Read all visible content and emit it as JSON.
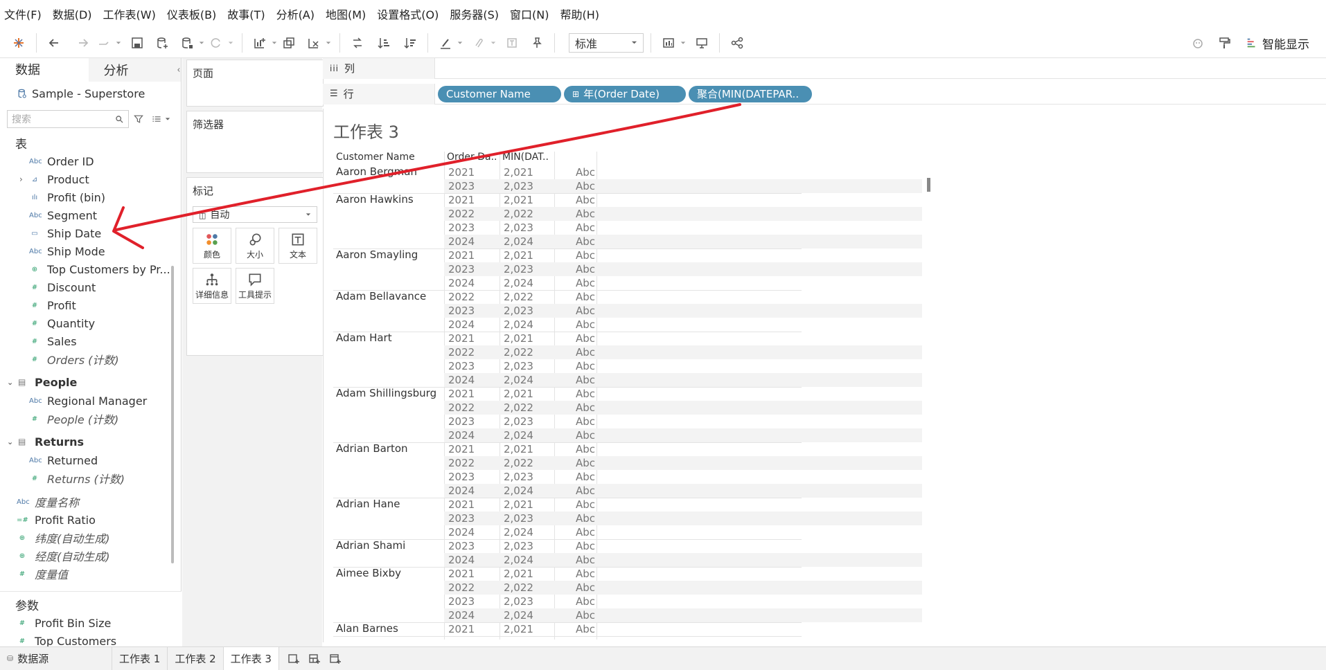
{
  "menu": [
    "文件(F)",
    "数据(D)",
    "工作表(W)",
    "仪表板(B)",
    "故事(T)",
    "分析(A)",
    "地图(M)",
    "设置格式(O)",
    "服务器(S)",
    "窗口(N)",
    "帮助(H)"
  ],
  "toolbar": {
    "fit_value": "标准",
    "show_me_label": "智能显示"
  },
  "data_pane": {
    "tab_data": "数据",
    "tab_analysis": "分析",
    "datasource": "Sample - Superstore",
    "search_placeholder": "搜索",
    "section_tables": "表",
    "fields": [
      {
        "icon": "Abc",
        "name": "Order ID"
      },
      {
        "icon": "⊿",
        "name": "Product"
      },
      {
        "icon": "ılı",
        "name": "Profit (bin)"
      },
      {
        "icon": "Abc",
        "name": "Segment"
      },
      {
        "icon": "▭",
        "name": "Ship Date"
      },
      {
        "icon": "Abc",
        "name": "Ship Mode"
      },
      {
        "icon": "⊕",
        "name": "Top Customers by Pr..."
      },
      {
        "icon": "#",
        "name": "Discount"
      },
      {
        "icon": "#",
        "name": "Profit"
      },
      {
        "icon": "#",
        "name": "Quantity"
      },
      {
        "icon": "#",
        "name": "Sales"
      },
      {
        "icon": "#",
        "name": "Orders (计数)"
      }
    ],
    "people_table": "People",
    "people_fields": [
      {
        "icon": "Abc",
        "name": "Regional Manager"
      },
      {
        "icon": "#",
        "name": "People (计数)"
      }
    ],
    "returns_table": "Returns",
    "returns_fields": [
      {
        "icon": "Abc",
        "name": "Returned"
      },
      {
        "icon": "#",
        "name": "Returns (计数)"
      }
    ],
    "extra_fields": [
      {
        "icon": "Abc",
        "name": "度量名称"
      },
      {
        "icon": "=#",
        "name": "Profit Ratio"
      },
      {
        "icon": "⊕",
        "name": "纬度(自动生成)"
      },
      {
        "icon": "⊕",
        "name": "经度(自动生成)"
      },
      {
        "icon": "#",
        "name": "度量值"
      }
    ],
    "section_params": "参数",
    "params": [
      {
        "icon": "#",
        "name": "Profit Bin Size"
      },
      {
        "icon": "#",
        "name": "Top Customers"
      }
    ]
  },
  "cards": {
    "pages": "页面",
    "filters": "筛选器",
    "marks": "标记",
    "marks_type": "自动",
    "mark_buttons": [
      "颜色",
      "大小",
      "文本",
      "详细信息",
      "工具提示"
    ]
  },
  "shelves": {
    "columns_label": "列",
    "rows_label": "行",
    "row_pills": [
      "Customer Name",
      "年(Order Date)",
      "聚合(MIN(DATEPAR.."
    ]
  },
  "sheet": {
    "title": "工作表 3",
    "headers": [
      "Customer Name",
      "Order Da..",
      "MIN(DAT.."
    ],
    "groups": [
      {
        "name": "Aaron Bergman",
        "rows": [
          [
            "2021",
            "2,021",
            "Abc"
          ],
          [
            "2023",
            "2,023",
            "Abc"
          ]
        ]
      },
      {
        "name": "Aaron Hawkins",
        "rows": [
          [
            "2021",
            "2,021",
            "Abc"
          ],
          [
            "2022",
            "2,022",
            "Abc"
          ],
          [
            "2023",
            "2,023",
            "Abc"
          ],
          [
            "2024",
            "2,024",
            "Abc"
          ]
        ]
      },
      {
        "name": "Aaron Smayling",
        "rows": [
          [
            "2021",
            "2,021",
            "Abc"
          ],
          [
            "2023",
            "2,023",
            "Abc"
          ],
          [
            "2024",
            "2,024",
            "Abc"
          ]
        ]
      },
      {
        "name": "Adam Bellavance",
        "rows": [
          [
            "2022",
            "2,022",
            "Abc"
          ],
          [
            "2023",
            "2,023",
            "Abc"
          ],
          [
            "2024",
            "2,024",
            "Abc"
          ]
        ]
      },
      {
        "name": "Adam Hart",
        "rows": [
          [
            "2021",
            "2,021",
            "Abc"
          ],
          [
            "2022",
            "2,022",
            "Abc"
          ],
          [
            "2023",
            "2,023",
            "Abc"
          ],
          [
            "2024",
            "2,024",
            "Abc"
          ]
        ]
      },
      {
        "name": "Adam Shillingsburg",
        "rows": [
          [
            "2021",
            "2,021",
            "Abc"
          ],
          [
            "2022",
            "2,022",
            "Abc"
          ],
          [
            "2023",
            "2,023",
            "Abc"
          ],
          [
            "2024",
            "2,024",
            "Abc"
          ]
        ]
      },
      {
        "name": "Adrian Barton",
        "rows": [
          [
            "2021",
            "2,021",
            "Abc"
          ],
          [
            "2022",
            "2,022",
            "Abc"
          ],
          [
            "2023",
            "2,023",
            "Abc"
          ],
          [
            "2024",
            "2,024",
            "Abc"
          ]
        ]
      },
      {
        "name": "Adrian Hane",
        "rows": [
          [
            "2021",
            "2,021",
            "Abc"
          ],
          [
            "2023",
            "2,023",
            "Abc"
          ],
          [
            "2024",
            "2,024",
            "Abc"
          ]
        ]
      },
      {
        "name": "Adrian Shami",
        "rows": [
          [
            "2023",
            "2,023",
            "Abc"
          ],
          [
            "2024",
            "2,024",
            "Abc"
          ]
        ]
      },
      {
        "name": "Aimee Bixby",
        "rows": [
          [
            "2021",
            "2,021",
            "Abc"
          ],
          [
            "2022",
            "2,022",
            "Abc"
          ],
          [
            "2023",
            "2,023",
            "Abc"
          ],
          [
            "2024",
            "2,024",
            "Abc"
          ]
        ]
      },
      {
        "name": "Alan Barnes",
        "rows": [
          [
            "2021",
            "2,021",
            "Abc"
          ]
        ]
      }
    ]
  },
  "bottom_tabs": {
    "datasource": "数据源",
    "sheets": [
      "工作表 1",
      "工作表 2",
      "工作表 3"
    ],
    "active": "工作表 3"
  },
  "colors": {
    "pill": "#4a8fb3",
    "arrow": "#e0202a",
    "icon_blue": "#4e79a7",
    "icon_green": "#2a9d6a"
  }
}
